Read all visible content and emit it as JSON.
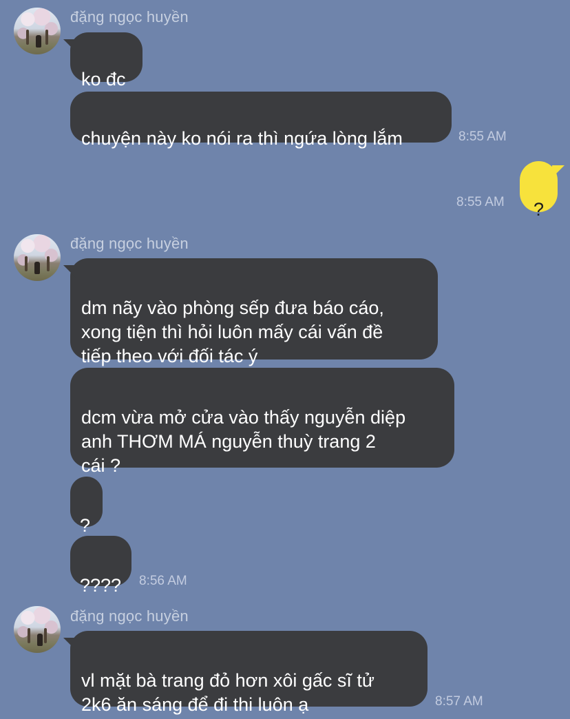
{
  "contact": {
    "name": "đặng ngọc huyền"
  },
  "messages": {
    "g1": {
      "sender": "đặng ngọc huyền",
      "m1": "ko đc",
      "m2": "chuyện này ko nói ra thì ngứa lòng lắm",
      "time": "8:55 AM"
    },
    "mine": {
      "m1": "?",
      "time": "8:55 AM"
    },
    "g2": {
      "sender": "đặng ngọc huyền",
      "m1": "dm nãy vào phòng sếp đưa báo cáo,\nxong tiện thì hỏi luôn mấy cái vấn đề\ntiếp theo với đối tác ý",
      "m2": "dcm vừa mở cửa vào thấy nguyễn diệp\nanh THƠM MÁ nguyễn thuỳ trang 2\ncái ?",
      "m3": "?",
      "m4": "????",
      "time": "8:56 AM"
    },
    "g3": {
      "sender": "đặng ngọc huyền",
      "m1": "vl mặt bà trang đỏ hơn xôi gấc sĩ tử\n2k6 ăn sáng để đi thi luôn ạ",
      "time": "8:57 AM"
    }
  },
  "colors": {
    "background": "#6f84ab",
    "incoming_bubble": "#3b3c3f",
    "outgoing_bubble": "#f7e23c"
  }
}
